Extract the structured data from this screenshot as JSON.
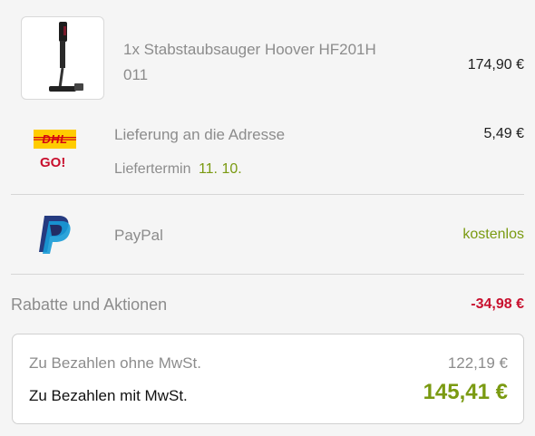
{
  "order": {
    "product": {
      "quantity_name": "1x Stabstaubsauger Hoover HF201H 011",
      "price": "174,90 €",
      "image_icon": "stick-vacuum-icon"
    },
    "delivery": {
      "carrier_icon": "dhl-go-logo",
      "carrier_logo_text": "DHL",
      "carrier_sub_text": "GO!",
      "label": "Lieferung an die Adresse",
      "price": "5,49 €",
      "date_label": "Liefertermin",
      "date_value": "11. 10."
    },
    "payment": {
      "method_icon": "paypal-logo",
      "label": "PayPal",
      "price": "kostenlos"
    },
    "discount": {
      "label": "Rabatte und Aktionen",
      "value": "-34,98 €"
    },
    "summary": {
      "net_label": "Zu Bezahlen ohne MwSt.",
      "net_value": "122,19 €",
      "gross_label": "Zu Bezahlen mit MwSt.",
      "gross_value": "145,41 €"
    }
  },
  "colors": {
    "accent_green": "#7a9a11",
    "discount_red": "#c8102e",
    "dhl_yellow": "#ffcc00",
    "dhl_red": "#d40511",
    "paypal_dark": "#253b80",
    "paypal_light": "#179bd7"
  }
}
